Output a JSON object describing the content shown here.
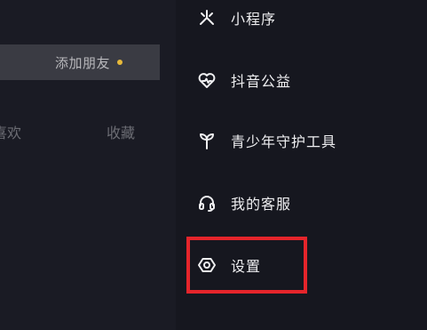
{
  "profile": {
    "add_friend": "添加朋友",
    "tabs": {
      "likes": "喜欢",
      "favorites": "收藏"
    }
  },
  "menu": {
    "items": [
      {
        "label": "小程序",
        "icon": "mini-program-icon"
      },
      {
        "label": "抖音公益",
        "icon": "charity-heart-icon"
      },
      {
        "label": "青少年守护工具",
        "icon": "sprout-icon"
      },
      {
        "label": "我的客服",
        "icon": "headset-icon"
      },
      {
        "label": "设置",
        "icon": "settings-hexagon-icon"
      }
    ]
  },
  "colors": {
    "highlight": "#e5252b",
    "notification_dot": "#e7b93a"
  }
}
